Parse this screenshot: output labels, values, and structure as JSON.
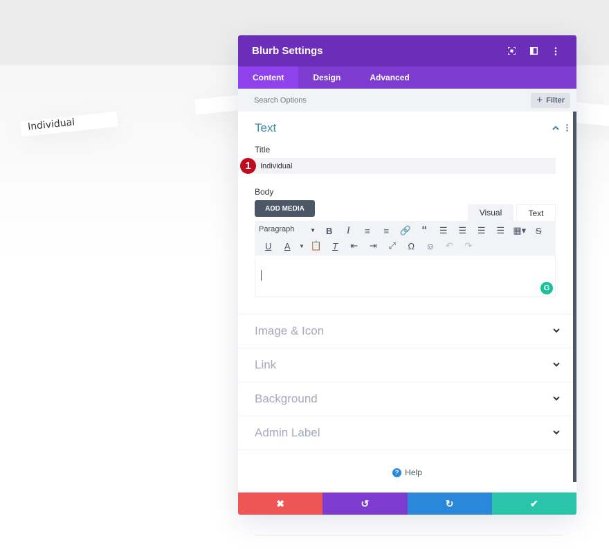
{
  "background": {
    "card_label": "Individual"
  },
  "modal": {
    "title": "Blurb Settings",
    "header_icons": [
      "expand-icon",
      "split-view-icon",
      "more-options-icon"
    ],
    "tabs": [
      {
        "label": "Content",
        "active": true
      },
      {
        "label": "Design",
        "active": false
      },
      {
        "label": "Advanced",
        "active": false
      }
    ],
    "search": {
      "placeholder": "Search Options",
      "filter_label": "Filter"
    },
    "text_section": {
      "title": "Text",
      "title_field": {
        "label": "Title",
        "value": "Individual",
        "badge": "1"
      },
      "body_field": {
        "label": "Body",
        "add_media_label": "ADD MEDIA",
        "editor_tabs": [
          "Visual",
          "Text"
        ],
        "format_select": "Paragraph",
        "body_value": ""
      }
    },
    "collapsed_sections": [
      {
        "title": "Image & Icon"
      },
      {
        "title": "Link"
      },
      {
        "title": "Background"
      },
      {
        "title": "Admin Label"
      }
    ],
    "help_label": "Help",
    "footer": {
      "buttons": [
        {
          "action": "discard",
          "color": "#ef5555"
        },
        {
          "action": "undo",
          "color": "#7e3bd0"
        },
        {
          "action": "redo",
          "color": "#2b87da"
        },
        {
          "action": "save",
          "color": "#29c4a9"
        }
      ]
    },
    "colors": {
      "header": "#6c2eb9",
      "tabs": "#7d3bcf",
      "active_tab": "#8f42ec",
      "section_title": "#3a8ca4",
      "badge": "#c00d1e"
    }
  }
}
